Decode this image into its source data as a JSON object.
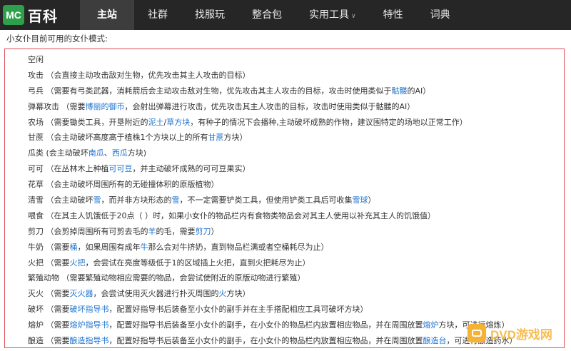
{
  "header": {
    "logo_badge": "MC",
    "logo_text": "百科",
    "nav": [
      {
        "label": "主站",
        "active": true
      },
      {
        "label": "社群"
      },
      {
        "label": "找服玩"
      },
      {
        "label": "整合包"
      },
      {
        "label": "实用工具",
        "dropdown": true
      },
      {
        "label": "特性"
      },
      {
        "label": "词典"
      }
    ]
  },
  "content": {
    "intro": "小女仆目前可用的女仆模式:",
    "modes": [
      [
        {
          "t": "空闲"
        }
      ],
      [
        {
          "t": "攻击 （会直接主动攻击敌对生物，优先攻击其主人攻击的目标）"
        }
      ],
      [
        {
          "t": "弓兵 （需要有弓类武器，消耗箭后会主动攻击敌对生物，优先攻击其主人攻击的目标，攻击时使用类似于"
        },
        {
          "t": "骷髅",
          "link": true
        },
        {
          "t": "的AI）"
        }
      ],
      [
        {
          "t": "弹幕攻击 （需要"
        },
        {
          "t": "博丽的御币",
          "link": true
        },
        {
          "t": "，会射出弹幕进行攻击，优先攻击其主人攻击的目标，攻击时使用类似于骷髅的AI）"
        }
      ],
      [
        {
          "t": "农场 （需要锄类工具，开垦附近的"
        },
        {
          "t": "泥土",
          "link": true
        },
        {
          "t": "/"
        },
        {
          "t": "草方块",
          "link": true
        },
        {
          "t": "，有种子的情况下会播种,主动破坏成熟的作物，建议围特定的场地以正常工作）"
        }
      ],
      [
        {
          "t": "甘蔗 （会主动破坏高度高于植株1个方块以上的所有"
        },
        {
          "t": "甘蔗",
          "link": true
        },
        {
          "t": "方块）"
        }
      ],
      [
        {
          "t": "瓜类 (会主动破坏"
        },
        {
          "t": "南瓜",
          "link": true
        },
        {
          "t": "、"
        },
        {
          "t": "西瓜",
          "link": true
        },
        {
          "t": "方块)"
        }
      ],
      [
        {
          "t": "可可 （在丛林木上种植"
        },
        {
          "t": "可可豆",
          "link": true
        },
        {
          "t": "，并主动破坏成熟的可可豆果实）"
        }
      ],
      [
        {
          "t": "花草 （会主动破坏周围所有的无碰撞体积的原版植物）"
        }
      ],
      [
        {
          "t": "清雪 （会主动破坏"
        },
        {
          "t": "雪",
          "link": true
        },
        {
          "t": "，而并非方块形态的"
        },
        {
          "t": "雪",
          "link": true
        },
        {
          "t": "，不一定需要铲类工具，但使用铲类工具后可收集"
        },
        {
          "t": "雪球",
          "link": true
        },
        {
          "t": "）"
        }
      ],
      [
        {
          "t": "喂食 （在其主人饥饿低于20点（                                  ）时，如果小女仆的物品栏内有食物类物品会对其主人使用以补充其主人的饥饿值）"
        }
      ],
      [
        {
          "t": "剪刀 （会剪掉周围所有可剪去毛的"
        },
        {
          "t": "羊",
          "link": true
        },
        {
          "t": "的毛，需要"
        },
        {
          "t": "剪刀",
          "link": true
        },
        {
          "t": "）"
        }
      ],
      [
        {
          "t": "牛奶 （需要"
        },
        {
          "t": "桶",
          "link": true
        },
        {
          "t": "，如果周围有成年"
        },
        {
          "t": "牛",
          "link": true
        },
        {
          "t": "那么会对牛挤奶，直到物品栏满或者空桶耗尽为止）"
        }
      ],
      [
        {
          "t": "火把 （需要"
        },
        {
          "t": "火把",
          "link": true
        },
        {
          "t": "，会尝试在亮度等级低于1的区域插上火把，直到火把耗尽为止）"
        }
      ],
      [
        {
          "t": "繁殖动物 （需要繁殖动物相应需要的物品，会尝试使附近的原版动物进行繁殖）"
        }
      ],
      [
        {
          "t": "灭火 （需要"
        },
        {
          "t": "灭火器",
          "link": true
        },
        {
          "t": "，会尝试使用灭火器进行扑灭周围的"
        },
        {
          "t": "火",
          "link": true
        },
        {
          "t": "方块）"
        }
      ],
      [
        {
          "t": "破坏 （需要"
        },
        {
          "t": "破坏指导书",
          "link": true
        },
        {
          "t": "，配置好指导书后装备至小女仆的副手并在主手搭配相应工具可破坏方块）"
        }
      ],
      [
        {
          "t": "熔炉 （需要"
        },
        {
          "t": "熔炉指导书",
          "link": true
        },
        {
          "t": "，配置好指导书后装备至小女仆的副手，在小女仆的物品栏内放置相应物品，并在周围放置"
        },
        {
          "t": "熔炉",
          "link": true
        },
        {
          "t": "方块，可进行熔炼）"
        }
      ],
      [
        {
          "t": "酿造 （需要"
        },
        {
          "t": "酿造指导书",
          "link": true
        },
        {
          "t": "，配置好指导书后装备至小女仆的副手，在小女仆的物品栏内放置相应物品，并在周围放置"
        },
        {
          "t": "酿造台",
          "link": true
        },
        {
          "t": "，可进行酿造药水）"
        }
      ]
    ]
  },
  "watermark": {
    "text": "DVD游戏网"
  },
  "colors": {
    "topbar": "#262626",
    "logo_green": "#2ea04c",
    "link": "#1e74d2",
    "box_border": "#e0505a",
    "watermark": "#f6b233"
  }
}
